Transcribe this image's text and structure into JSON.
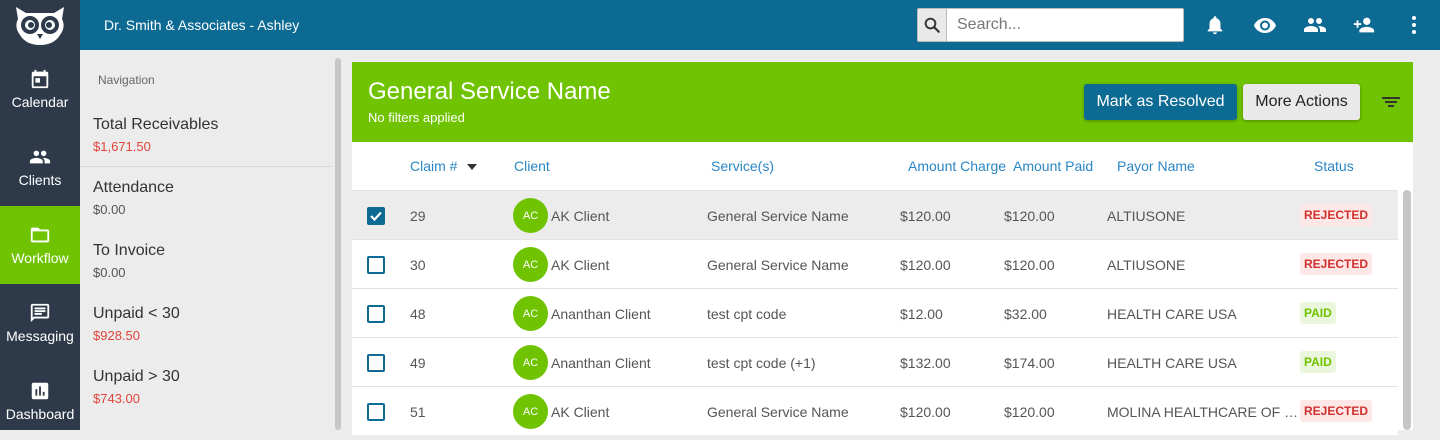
{
  "header": {
    "company": "Dr. Smith & Associates - Ashley",
    "search_placeholder": "Search...",
    "icons": [
      "bell-icon",
      "eye-icon",
      "people-icon",
      "add-person-icon",
      "more-vert-icon"
    ]
  },
  "leftnav": {
    "items": [
      {
        "label": "Calendar",
        "icon": "calendar-icon"
      },
      {
        "label": "Clients",
        "icon": "people-icon"
      },
      {
        "label": "Workflow",
        "icon": "folder-icon",
        "active": true
      },
      {
        "label": "Messaging",
        "icon": "message-icon"
      },
      {
        "label": "Dashboard",
        "icon": "chart-icon"
      }
    ]
  },
  "sidepanel": {
    "heading": "Navigation",
    "items": [
      {
        "label": "Total Receivables",
        "value": "$1,671.50"
      },
      {
        "label": "Attendance",
        "value": "$0.00"
      },
      {
        "label": "To Invoice",
        "value": "$0.00"
      },
      {
        "label": "Unpaid < 30",
        "value": "$928.50"
      },
      {
        "label": "Unpaid > 30",
        "value": "$743.00"
      }
    ]
  },
  "card": {
    "title": "General Service Name",
    "subtitle": "No filters applied",
    "resolve_label": "Mark as Resolved",
    "more_label": "More Actions"
  },
  "table": {
    "columns": {
      "claim": "Claim #",
      "client": "Client",
      "services": "Service(s)",
      "amount_charge": "Amount Charge",
      "amount_paid": "Amount Paid",
      "payor": "Payor Name",
      "status": "Status"
    },
    "rows": [
      {
        "checked": true,
        "claim": "29",
        "initials": "AC",
        "client": "AK Client",
        "service": "General Service Name",
        "charge": "$120.00",
        "paid": "$120.00",
        "payor": "ALTIUSONE",
        "status": "REJECTED"
      },
      {
        "checked": false,
        "claim": "30",
        "initials": "AC",
        "client": "AK Client",
        "service": "General Service Name",
        "charge": "$120.00",
        "paid": "$120.00",
        "payor": "ALTIUSONE",
        "status": "REJECTED"
      },
      {
        "checked": false,
        "claim": "48",
        "initials": "AC",
        "client": "Ananthan Client",
        "service": "test cpt code",
        "charge": "$12.00",
        "paid": "$32.00",
        "payor": "HEALTH CARE USA",
        "status": "PAID"
      },
      {
        "checked": false,
        "claim": "49",
        "initials": "AC",
        "client": "Ananthan Client",
        "service": "test cpt code (+1)",
        "charge": "$132.00",
        "paid": "$174.00",
        "payor": "HEALTH CARE USA",
        "status": "PAID"
      },
      {
        "checked": false,
        "claim": "51",
        "initials": "AC",
        "client": "AK Client",
        "service": "General Service Name",
        "charge": "$120.00",
        "paid": "$120.00",
        "payor": "MOLINA HEALTHCARE OF …",
        "status": "REJECTED"
      }
    ]
  },
  "colors": {
    "brand_blue": "#0d6a92",
    "brand_green": "#6fc300",
    "nav_dark": "#2e3a4a",
    "link_blue": "#2b86c5",
    "rejected_red": "#d0312d"
  }
}
